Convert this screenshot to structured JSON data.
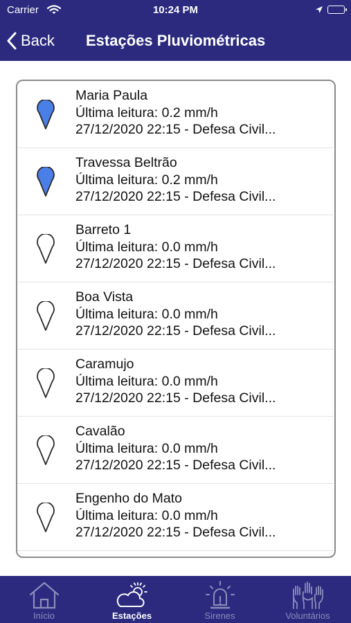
{
  "status_bar": {
    "carrier": "Carrier",
    "time": "10:24 PM"
  },
  "nav": {
    "back_label": "Back",
    "title": "Estações Pluviométricas"
  },
  "stations": [
    {
      "name": "Maria Paula",
      "reading": "Última leitura: 0.2 mm/h",
      "timestamp": "27/12/2020 22:15 - Defesa Civil...",
      "pin": "filled-pin-icon"
    },
    {
      "name": "Travessa Beltrão",
      "reading": "Última leitura: 0.2 mm/h",
      "timestamp": "27/12/2020 22:15 - Defesa Civil...",
      "pin": "filled-pin-icon"
    },
    {
      "name": "Barreto 1",
      "reading": "Última leitura: 0.0 mm/h",
      "timestamp": "27/12/2020 22:15 - Defesa Civil...",
      "pin": "outline-pin-icon"
    },
    {
      "name": "Boa Vista",
      "reading": "Última leitura: 0.0 mm/h",
      "timestamp": "27/12/2020 22:15 - Defesa Civil...",
      "pin": "outline-pin-icon"
    },
    {
      "name": "Caramujo",
      "reading": "Última leitura: 0.0 mm/h",
      "timestamp": "27/12/2020 22:15 - Defesa Civil...",
      "pin": "outline-pin-icon"
    },
    {
      "name": "Cavalão",
      "reading": "Última leitura: 0.0 mm/h",
      "timestamp": "27/12/2020 22:15 - Defesa Civil...",
      "pin": "outline-pin-icon"
    },
    {
      "name": "Engenho do Mato",
      "reading": "Última leitura: 0.0 mm/h",
      "timestamp": "27/12/2020 22:15 - Defesa Civil...",
      "pin": "outline-pin-icon"
    }
  ],
  "tabs": [
    {
      "label": "Início",
      "icon": "home-icon"
    },
    {
      "label": "Estações",
      "icon": "cloud-sun-icon",
      "active": true
    },
    {
      "label": "Sirenes",
      "icon": "siren-icon"
    },
    {
      "label": "Voluntários",
      "icon": "raised-hands-icon"
    }
  ],
  "colors": {
    "brand": "#2b2a7e",
    "pin_active": "#4a7fe8",
    "tab_inactive": "#8d8cbc"
  }
}
